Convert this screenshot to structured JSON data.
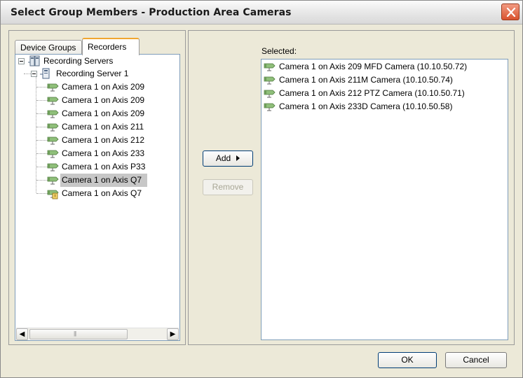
{
  "window": {
    "title": "Select Group Members - Production Area Cameras"
  },
  "tabs": [
    {
      "label": "Device Groups",
      "active": false
    },
    {
      "label": "Recorders",
      "active": true
    }
  ],
  "tree": {
    "root": "Recording Servers",
    "server": "Recording Server 1",
    "cameras": [
      {
        "label": "Camera 1 on Axis 209",
        "selected": false,
        "icon": "camera-icon"
      },
      {
        "label": "Camera 1 on Axis 209",
        "selected": false,
        "icon": "camera-icon"
      },
      {
        "label": "Camera 1 on Axis 209",
        "selected": false,
        "icon": "camera-icon"
      },
      {
        "label": "Camera 1 on Axis 211",
        "selected": false,
        "icon": "camera-icon"
      },
      {
        "label": "Camera 1 on Axis 212",
        "selected": false,
        "icon": "camera-icon"
      },
      {
        "label": "Camera 1 on Axis 233",
        "selected": false,
        "icon": "camera-icon"
      },
      {
        "label": "Camera 1 on Axis P33",
        "selected": false,
        "icon": "camera-icon"
      },
      {
        "label": "Camera 1 on Axis Q7",
        "selected": true,
        "icon": "camera-icon"
      },
      {
        "label": "Camera 1 on Axis Q7",
        "selected": false,
        "icon": "camera-warning-icon"
      }
    ]
  },
  "buttons": {
    "add": "Add",
    "remove": "Remove",
    "ok": "OK",
    "cancel": "Cancel"
  },
  "selected": {
    "label": "Selected:",
    "items": [
      "Camera 1 on Axis 209 MFD Camera (10.10.50.72)",
      "Camera 1 on Axis 211M Camera (10.10.50.74)",
      "Camera 1 on Axis 212 PTZ Camera (10.10.50.71)",
      "Camera 1 on Axis 233D Camera (10.10.50.58)"
    ]
  },
  "colors": {
    "camera_body": "#8fbf7a",
    "accent_tab": "#f0a630",
    "close_button": "#d9532e"
  }
}
